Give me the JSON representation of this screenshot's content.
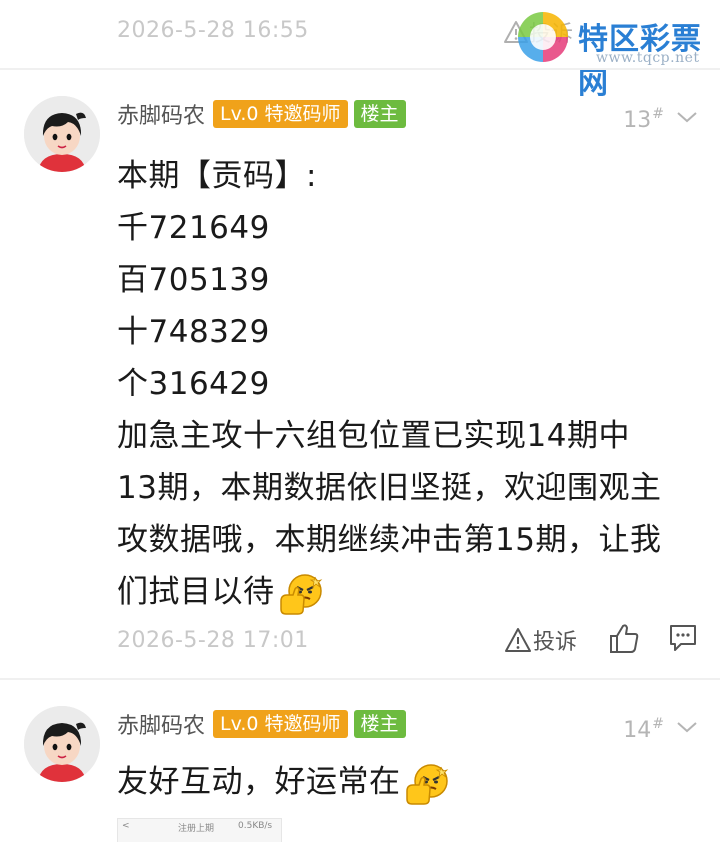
{
  "top": {
    "time": "2026-5-28 16:55",
    "report_label": "投诉"
  },
  "watermark": {
    "text": "特区彩票网",
    "url": "www.tqcp.net"
  },
  "comments": [
    {
      "user": "赤脚码农",
      "level_badge": "Lv.0 特邀码师",
      "owner_badge": "楼主",
      "floor": "13",
      "floor_mark": "#",
      "lines": [
        "本期【贡码】:",
        "千721649",
        "百705139",
        "十748329",
        "个316429",
        "加急主攻十六组包位置已实现14期中",
        "13期，本期数据依旧坚挺，欢迎围观主",
        "攻数据哦，本期继续冲击第15期，让我",
        "们拭目以待"
      ],
      "emoji": "thumbs-up-emoji",
      "time": "2026-5-28 17:01",
      "report_label": "投诉"
    },
    {
      "user": "赤脚码农",
      "level_badge": "Lv.0 特邀码师",
      "owner_badge": "楼主",
      "floor": "14",
      "floor_mark": "#",
      "lines": [
        "友好互动，好运常在"
      ],
      "emoji": "thumbs-up-emoji"
    }
  ],
  "thumbnail": {
    "left_text": "<",
    "center_text": "注册上期",
    "right_text": "0.5KB/s"
  },
  "colors": {
    "level_badge": "#f0a21a",
    "owner_badge": "#6dbb3f",
    "watermark_blue": "#2a7fd4",
    "muted_text": "#c8c8c8"
  }
}
